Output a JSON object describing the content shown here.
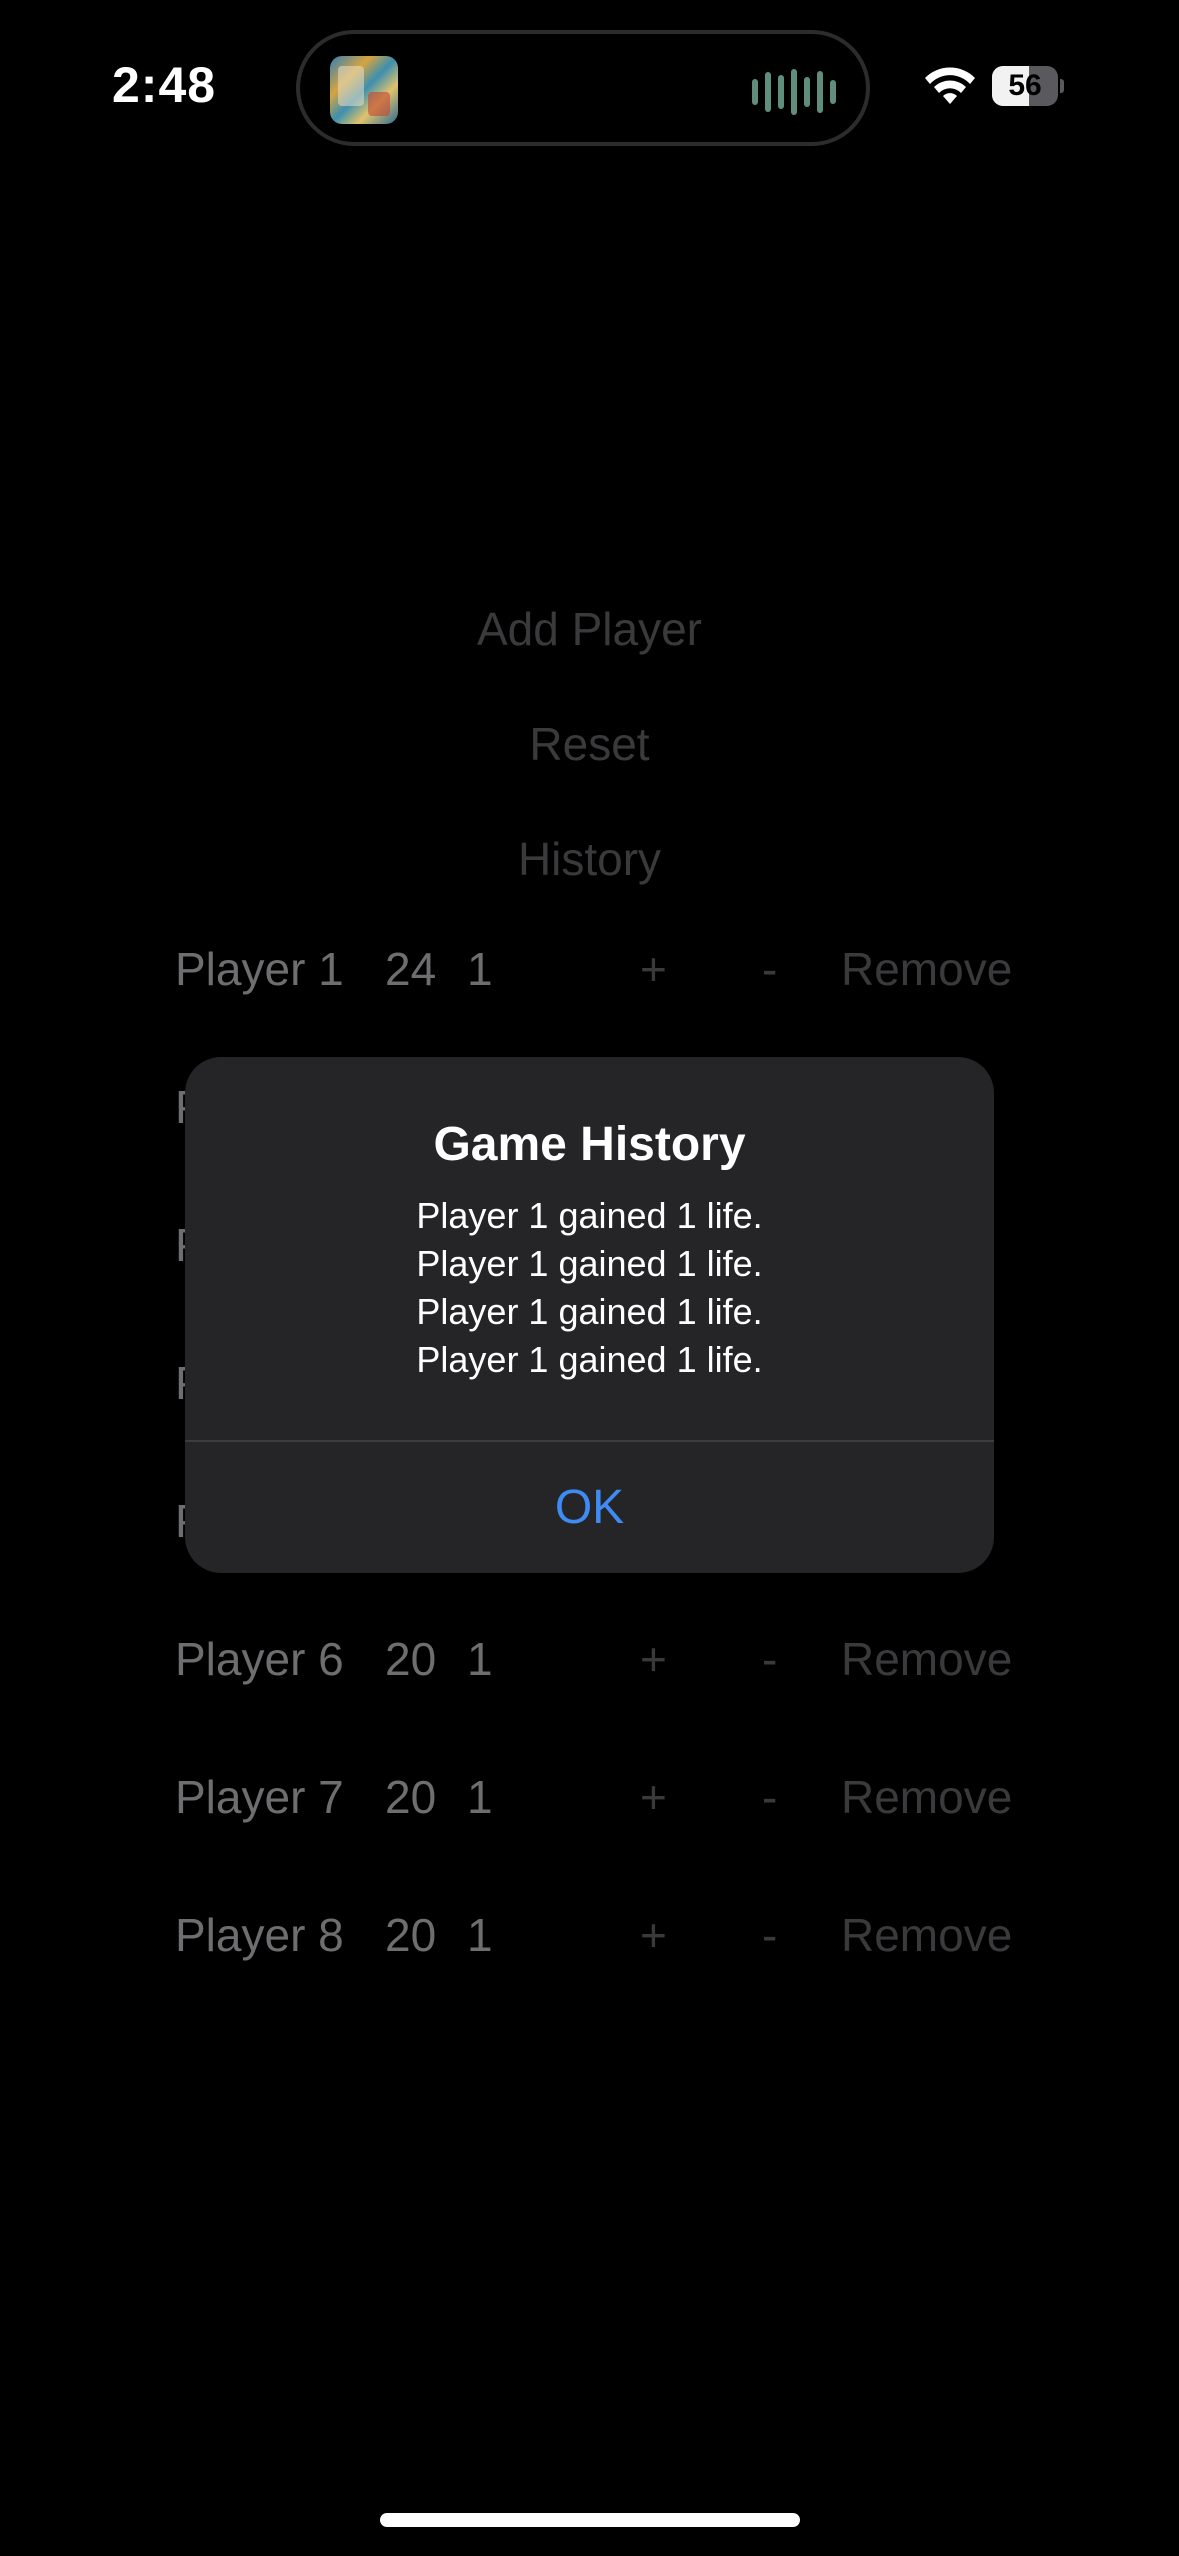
{
  "status_bar": {
    "time": "2:48",
    "battery_level": "56",
    "battery_fraction": 0.56,
    "wifi_icon": "wifi-icon",
    "media_activity_icon": "waveform-icon"
  },
  "actions": {
    "add_player": "Add Player",
    "reset": "Reset",
    "history": "History"
  },
  "players": [
    {
      "name": "Player 1",
      "life": "24",
      "count": "1",
      "plus": "+",
      "minus": "-",
      "remove": "Remove"
    },
    {
      "name": "P",
      "life": "",
      "count": "",
      "plus": "",
      "minus": "",
      "remove": "e"
    },
    {
      "name": "P",
      "life": "",
      "count": "",
      "plus": "",
      "minus": "",
      "remove": "e"
    },
    {
      "name": "P",
      "life": "",
      "count": "",
      "plus": "",
      "minus": "",
      "remove": "e"
    },
    {
      "name": "P",
      "life": "",
      "count": "",
      "plus": "",
      "minus": "",
      "remove": "e"
    },
    {
      "name": "Player 6",
      "life": "20",
      "count": "1",
      "plus": "+",
      "minus": "-",
      "remove": "Remove"
    },
    {
      "name": "Player 7",
      "life": "20",
      "count": "1",
      "plus": "+",
      "minus": "-",
      "remove": "Remove"
    },
    {
      "name": "Player 8",
      "life": "20",
      "count": "1",
      "plus": "+",
      "minus": "-",
      "remove": "Remove"
    }
  ],
  "alert": {
    "title": "Game History",
    "messages": [
      "Player 1 gained 1 life.",
      "Player 1 gained 1 life.",
      "Player 1 gained 1 life.",
      "Player 1 gained 1 life."
    ],
    "ok_label": "OK",
    "ok_color": "#3d8bf3"
  },
  "colors": {
    "background": "#000000",
    "alert_background": "#252527",
    "dim_text": "#6e6e70"
  }
}
